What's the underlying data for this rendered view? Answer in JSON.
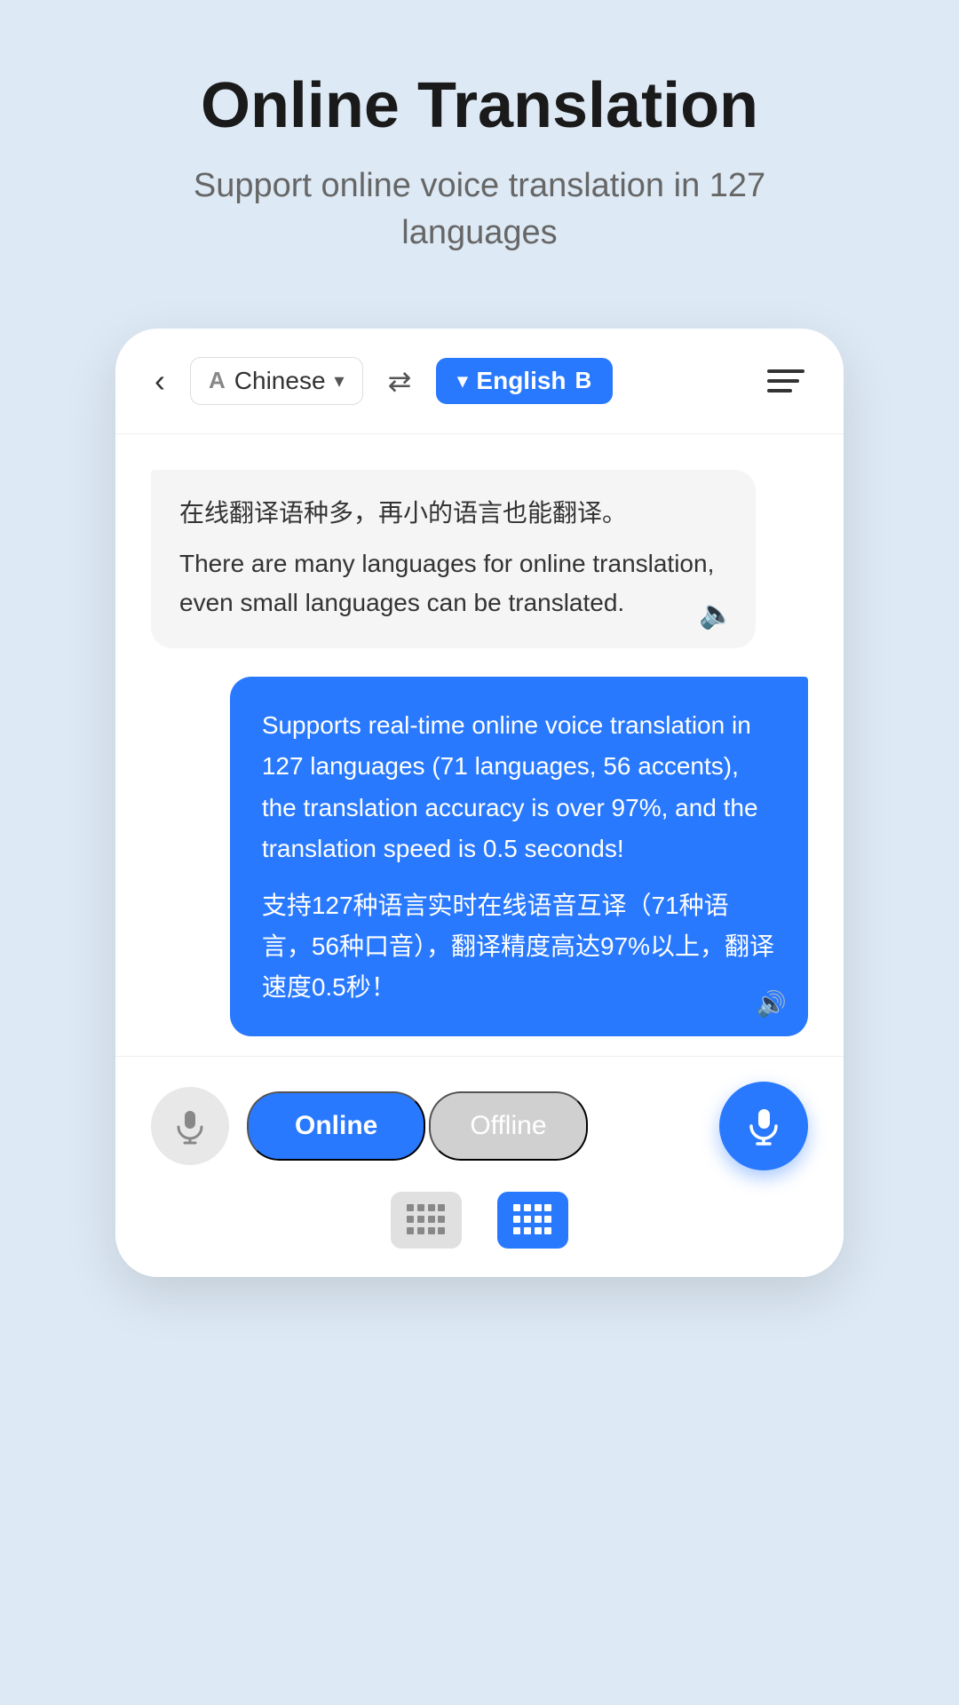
{
  "header": {
    "title": "Online Translation",
    "subtitle": "Support online voice translation in 127 languages"
  },
  "topbar": {
    "back_label": "‹",
    "lang_a_letter": "A",
    "lang_a_name": "Chinese",
    "swap_icon": "⇄",
    "lang_b_letter": "B",
    "lang_b_name": "English"
  },
  "messages": [
    {
      "direction": "left",
      "original": "在线翻译语种多，再小的语言也能翻译。",
      "translated": "There are many languages for online translation, even small languages can be translated."
    },
    {
      "direction": "right",
      "text_en": "Supports real-time online voice translation in 127 languages (71 languages, 56 accents), the translation accuracy is over 97%, and the translation speed is 0.5 seconds!",
      "text_cn": "支持127种语言实时在线语音互译（71种语言，56种口音），翻译精度高达97%以上，翻译速度0.5秒！"
    }
  ],
  "bottom": {
    "mode_online": "Online",
    "mode_offline": "Offline"
  }
}
